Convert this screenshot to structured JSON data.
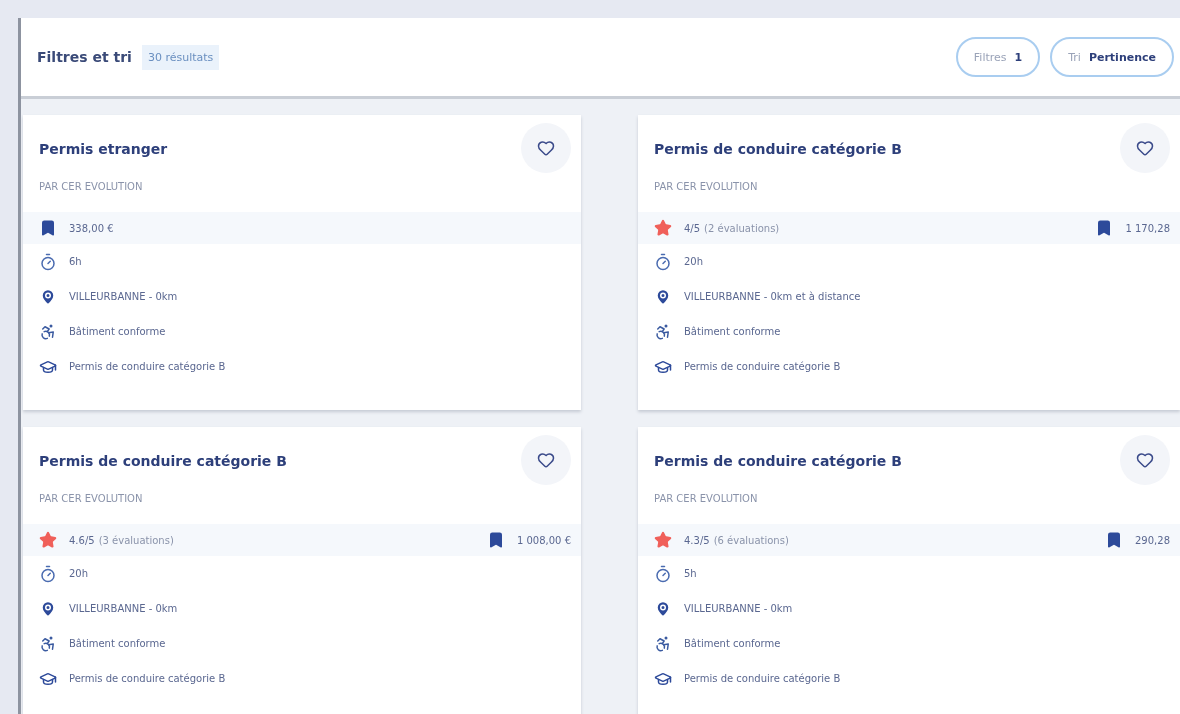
{
  "header": {
    "title": "Filtres et tri",
    "results": "30 résultats",
    "filters_button": {
      "label": "Filtres",
      "count": "1"
    },
    "sort_button": {
      "label": "Tri",
      "value": "Pertinence"
    }
  },
  "cards": [
    {
      "title": "Permis etranger",
      "provider": "PAR CER EVOLUTION",
      "price": "338,00 €",
      "details": [
        {
          "kind": "duration",
          "text": "6h"
        },
        {
          "kind": "location",
          "text": "VILLEURBANNE - 0km"
        },
        {
          "kind": "accessibility",
          "text": "Bâtiment conforme"
        },
        {
          "kind": "certification",
          "text": "Permis de conduire catégorie B"
        }
      ]
    },
    {
      "title": "Permis de conduire catégorie B",
      "provider": "PAR CER EVOLUTION",
      "rating": "4/5",
      "reviews": "(2 évaluations)",
      "price": "1 170,28",
      "details": [
        {
          "kind": "duration",
          "text": "20h"
        },
        {
          "kind": "location",
          "text": "VILLEURBANNE - 0km et à distance"
        },
        {
          "kind": "accessibility",
          "text": "Bâtiment conforme"
        },
        {
          "kind": "certification",
          "text": "Permis de conduire catégorie B"
        }
      ]
    },
    {
      "title": "Permis de conduire catégorie B",
      "provider": "PAR CER EVOLUTION",
      "rating": "4.6/5",
      "reviews": "(3 évaluations)",
      "price": "1 008,00 €",
      "details": [
        {
          "kind": "duration",
          "text": "20h"
        },
        {
          "kind": "location",
          "text": "VILLEURBANNE - 0km"
        },
        {
          "kind": "accessibility",
          "text": "Bâtiment conforme"
        },
        {
          "kind": "certification",
          "text": "Permis de conduire catégorie B"
        }
      ]
    },
    {
      "title": "Permis de conduire catégorie B",
      "provider": "PAR CER EVOLUTION",
      "rating": "4.3/5",
      "reviews": "(6 évaluations)",
      "price": "290,28",
      "details": [
        {
          "kind": "duration",
          "text": "5h"
        },
        {
          "kind": "location",
          "text": "VILLEURBANNE - 0km"
        },
        {
          "kind": "accessibility",
          "text": "Bâtiment conforme"
        },
        {
          "kind": "certification",
          "text": "Permis de conduire catégorie B"
        }
      ]
    }
  ]
}
